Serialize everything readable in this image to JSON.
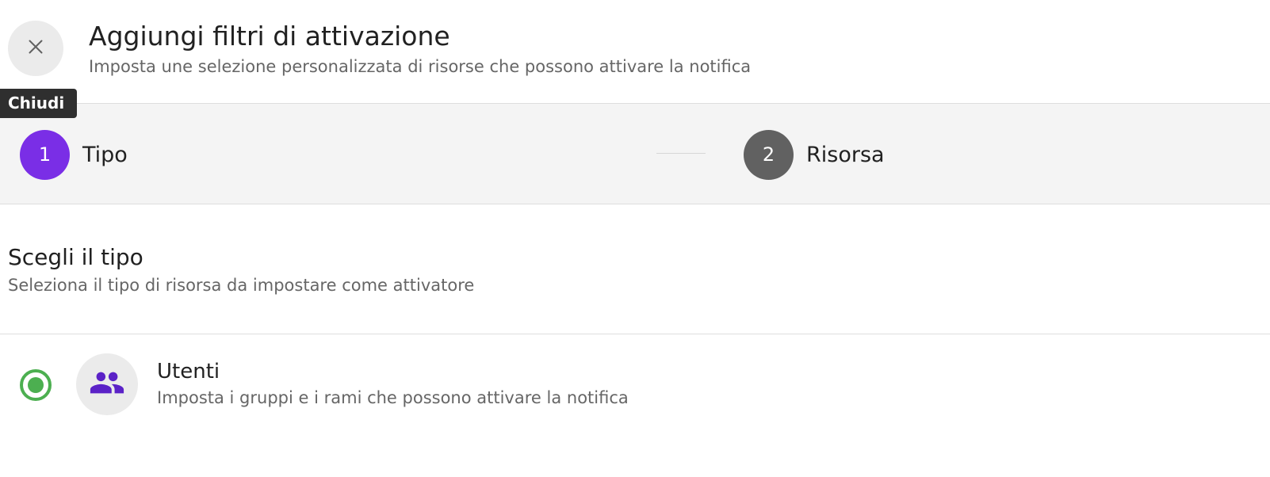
{
  "dialog": {
    "title": "Aggiungi filtri di attivazione",
    "subtitle": "Imposta une selezione personalizzata di risorse che possono attivare la notifica",
    "close_icon": "close-icon",
    "close_tooltip": "Chiudi"
  },
  "stepper": {
    "steps": [
      {
        "number": "1",
        "label": "Tipo",
        "state": "active"
      },
      {
        "number": "2",
        "label": "Risorsa",
        "state": "inactive"
      }
    ],
    "active_color": "#7a2ee6",
    "inactive_color": "#616161"
  },
  "section": {
    "title": "Scegli il tipo",
    "description": "Seleziona il tipo di risorsa da impostare come attivatore"
  },
  "options": [
    {
      "title": "Utenti",
      "description": "Imposta i gruppi e i rami che possono attivare la notifica",
      "icon": "users-group-icon",
      "selected": true
    }
  ],
  "colors": {
    "accent": "#7a2ee6",
    "radio_selected": "#4caf50",
    "icon_color": "#5b22c7"
  }
}
